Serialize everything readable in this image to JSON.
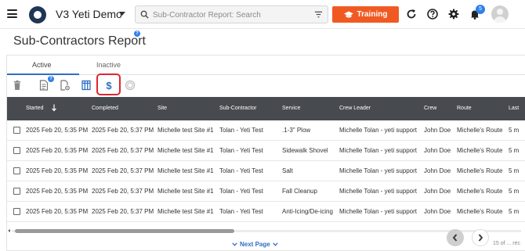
{
  "app": {
    "title": "V3 Yeti Demo",
    "accent": "#f05a22",
    "brand": "#1f3654"
  },
  "search": {
    "placeholder": "Sub-Contractor Report: Search",
    "value": ""
  },
  "topbar": {
    "training_label": "Training",
    "notification_count": "5"
  },
  "page": {
    "title": "Sub-Contractors Report",
    "help_badge": "?"
  },
  "tabs": [
    {
      "label": "Active",
      "active": true
    },
    {
      "label": "Inactive",
      "active": false
    }
  ],
  "toolbar": {
    "tools": [
      "delete-icon",
      "report-icon",
      "report-settings-icon",
      "columns-icon",
      "dollar-icon",
      "currency-icon"
    ],
    "help_badge": "?",
    "highlight_color": "#e0262f"
  },
  "table": {
    "columns": [
      "Started",
      "Completed",
      "Site",
      "Sub-Contractor",
      "Service",
      "Crew Leader",
      "Crew",
      "Route",
      "Last"
    ],
    "sorted_column": "Started",
    "sort_direction": "desc",
    "rows": [
      [
        "2025 Feb 20, 5:35 PM",
        "2025 Feb 20, 5:37 PM",
        "Michelle test Site #1",
        "Tolan - Yeti Test",
        ".1-3\" Plow",
        "Michelle Tolan - yeti support",
        "John Doe",
        "Michelle's Route",
        "5 m"
      ],
      [
        "2025 Feb 20, 5:35 PM",
        "2025 Feb 20, 5:37 PM",
        "Michelle test Site #1",
        "Tolan - Yeti Test",
        "Sidewalk Shovel",
        "Michelle Tolan - yeti support",
        "John Doe",
        "Michelle's Route",
        "5 m"
      ],
      [
        "2025 Feb 20, 5:35 PM",
        "2025 Feb 20, 5:37 PM",
        "Michelle test Site #1",
        "Tolan - Yeti Test",
        "Salt",
        "Michelle Tolan - yeti support",
        "John Doe",
        "Michelle's Route",
        "5 m"
      ],
      [
        "2025 Feb 20, 5:35 PM",
        "2025 Feb 20, 5:37 PM",
        "Michelle test Site #1",
        "Tolan - Yeti Test",
        "Fall Cleanup",
        "Michelle Tolan - yeti support",
        "John Doe",
        "Michelle's Route",
        "5 m"
      ],
      [
        "2025 Feb 20, 5:35 PM",
        "2025 Feb 20, 5:37 PM",
        "Michelle test Site #1",
        "Tolan - Yeti Test",
        "Anti-Icing/De-icing",
        "Michelle Tolan - yeti support",
        "John Doe",
        "Michelle's Route",
        "5 m"
      ]
    ]
  },
  "pagination": {
    "next_label": "Next Page",
    "records_text": "15 of ... rec"
  }
}
